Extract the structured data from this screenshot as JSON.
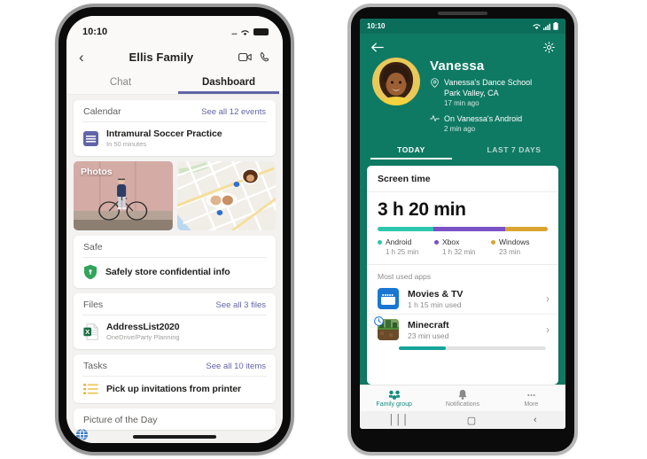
{
  "iphone": {
    "status": {
      "time": "10:10",
      "signal": "....",
      "icons": [
        "wifi-icon",
        "battery-icon"
      ]
    },
    "header": {
      "back_icon": "chevron-left-icon",
      "title": "Ellis Family",
      "video_icon": "video-call-icon",
      "call_icon": "phone-call-icon"
    },
    "tabs": [
      {
        "label": "Chat",
        "active": false
      },
      {
        "label": "Dashboard",
        "active": true
      }
    ],
    "cards": {
      "calendar": {
        "title": "Calendar",
        "link": "See all 12 events",
        "item_title": "Intramural Soccer Practice",
        "item_sub": "In 50 minutes"
      },
      "photos": {
        "label": "Photos"
      },
      "safe": {
        "title": "Safe",
        "item_title": "Safely store confidential info"
      },
      "files": {
        "title": "Files",
        "link": "See all 3 files",
        "item_title": "AddressList2020",
        "item_sub": "OneDrive/Party Planning"
      },
      "tasks": {
        "title": "Tasks",
        "link": "See all 10 items",
        "item_title": "Pick up invitations from printer"
      },
      "picture_of_day": {
        "title": "Picture of the Day"
      }
    },
    "accent": "#6264a7"
  },
  "android": {
    "status": {
      "time": "10:10",
      "icons": [
        "wifi-icon",
        "cellular-icon",
        "battery-icon"
      ]
    },
    "header": {
      "back_icon": "arrow-left-icon",
      "settings_icon": "gear-icon"
    },
    "profile": {
      "name": "Vanessa",
      "location_icon": "location-pin-icon",
      "location_line1": "Vanessa's Dance School",
      "location_line2": "Park Valley, CA",
      "location_time": "17 min ago",
      "activity_icon": "activity-pulse-icon",
      "activity_line1": "On Vanessa's Android",
      "activity_time": "2 min ago"
    },
    "tabs": [
      {
        "label": "TODAY",
        "active": true
      },
      {
        "label": "LAST 7 DAYS",
        "active": false
      }
    ],
    "screen_time": {
      "card_title": "Screen time",
      "total": "3 h 20 min",
      "breakdown": [
        {
          "name": "Android",
          "value": "1 h 25 min",
          "color": "#2dc7ac",
          "pct": 33
        },
        {
          "name": "Xbox",
          "value": "1 h 32 min",
          "color": "#7a52c7",
          "pct": 42
        },
        {
          "name": "Windows",
          "value": "23 min",
          "color": "#d9a430",
          "pct": 25
        }
      ]
    },
    "most_used": {
      "label": "Most used apps",
      "apps": [
        {
          "name": "Movies & TV",
          "used": "1 h 15 min used",
          "icon": "movies-tv-icon",
          "progress": 0
        },
        {
          "name": "Minecraft",
          "used": "23 min used",
          "icon": "minecraft-icon",
          "progress": 32
        }
      ]
    },
    "bottom_nav": [
      {
        "label": "Family group",
        "icon": "family-group-icon",
        "active": true
      },
      {
        "label": "Notifications",
        "icon": "bell-icon",
        "active": false
      },
      {
        "label": "More",
        "icon": "more-dots-icon",
        "active": false
      }
    ],
    "system_nav": [
      {
        "icon": "recents-icon"
      },
      {
        "icon": "home-icon"
      },
      {
        "icon": "back-icon"
      }
    ],
    "accent": "#0f7a64"
  }
}
